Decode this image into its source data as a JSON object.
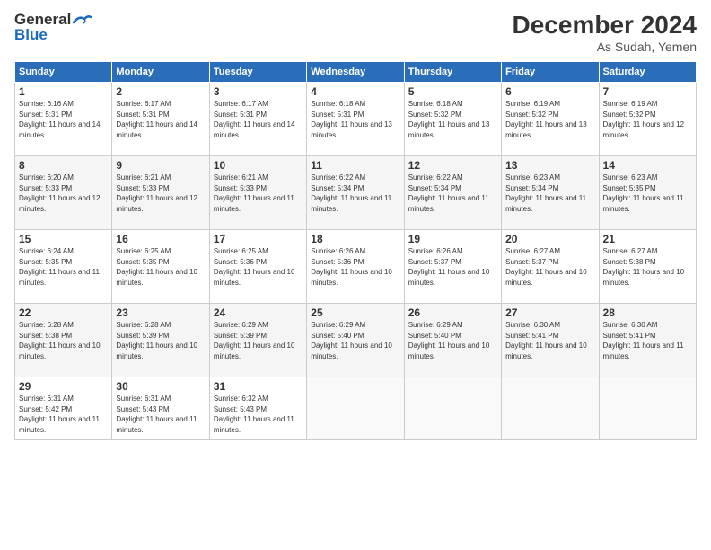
{
  "header": {
    "logo_general": "General",
    "logo_blue": "Blue",
    "month": "December 2024",
    "location": "As Sudah, Yemen"
  },
  "days_of_week": [
    "Sunday",
    "Monday",
    "Tuesday",
    "Wednesday",
    "Thursday",
    "Friday",
    "Saturday"
  ],
  "weeks": [
    [
      {
        "day": "1",
        "sunrise": "6:16 AM",
        "sunset": "5:31 PM",
        "daylight": "11 hours and 14 minutes."
      },
      {
        "day": "2",
        "sunrise": "6:17 AM",
        "sunset": "5:31 PM",
        "daylight": "11 hours and 14 minutes."
      },
      {
        "day": "3",
        "sunrise": "6:17 AM",
        "sunset": "5:31 PM",
        "daylight": "11 hours and 14 minutes."
      },
      {
        "day": "4",
        "sunrise": "6:18 AM",
        "sunset": "5:31 PM",
        "daylight": "11 hours and 13 minutes."
      },
      {
        "day": "5",
        "sunrise": "6:18 AM",
        "sunset": "5:32 PM",
        "daylight": "11 hours and 13 minutes."
      },
      {
        "day": "6",
        "sunrise": "6:19 AM",
        "sunset": "5:32 PM",
        "daylight": "11 hours and 13 minutes."
      },
      {
        "day": "7",
        "sunrise": "6:19 AM",
        "sunset": "5:32 PM",
        "daylight": "11 hours and 12 minutes."
      }
    ],
    [
      {
        "day": "8",
        "sunrise": "6:20 AM",
        "sunset": "5:33 PM",
        "daylight": "11 hours and 12 minutes."
      },
      {
        "day": "9",
        "sunrise": "6:21 AM",
        "sunset": "5:33 PM",
        "daylight": "11 hours and 12 minutes."
      },
      {
        "day": "10",
        "sunrise": "6:21 AM",
        "sunset": "5:33 PM",
        "daylight": "11 hours and 11 minutes."
      },
      {
        "day": "11",
        "sunrise": "6:22 AM",
        "sunset": "5:34 PM",
        "daylight": "11 hours and 11 minutes."
      },
      {
        "day": "12",
        "sunrise": "6:22 AM",
        "sunset": "5:34 PM",
        "daylight": "11 hours and 11 minutes."
      },
      {
        "day": "13",
        "sunrise": "6:23 AM",
        "sunset": "5:34 PM",
        "daylight": "11 hours and 11 minutes."
      },
      {
        "day": "14",
        "sunrise": "6:23 AM",
        "sunset": "5:35 PM",
        "daylight": "11 hours and 11 minutes."
      }
    ],
    [
      {
        "day": "15",
        "sunrise": "6:24 AM",
        "sunset": "5:35 PM",
        "daylight": "11 hours and 11 minutes."
      },
      {
        "day": "16",
        "sunrise": "6:25 AM",
        "sunset": "5:35 PM",
        "daylight": "11 hours and 10 minutes."
      },
      {
        "day": "17",
        "sunrise": "6:25 AM",
        "sunset": "5:36 PM",
        "daylight": "11 hours and 10 minutes."
      },
      {
        "day": "18",
        "sunrise": "6:26 AM",
        "sunset": "5:36 PM",
        "daylight": "11 hours and 10 minutes."
      },
      {
        "day": "19",
        "sunrise": "6:26 AM",
        "sunset": "5:37 PM",
        "daylight": "11 hours and 10 minutes."
      },
      {
        "day": "20",
        "sunrise": "6:27 AM",
        "sunset": "5:37 PM",
        "daylight": "11 hours and 10 minutes."
      },
      {
        "day": "21",
        "sunrise": "6:27 AM",
        "sunset": "5:38 PM",
        "daylight": "11 hours and 10 minutes."
      }
    ],
    [
      {
        "day": "22",
        "sunrise": "6:28 AM",
        "sunset": "5:38 PM",
        "daylight": "11 hours and 10 minutes."
      },
      {
        "day": "23",
        "sunrise": "6:28 AM",
        "sunset": "5:39 PM",
        "daylight": "11 hours and 10 minutes."
      },
      {
        "day": "24",
        "sunrise": "6:29 AM",
        "sunset": "5:39 PM",
        "daylight": "11 hours and 10 minutes."
      },
      {
        "day": "25",
        "sunrise": "6:29 AM",
        "sunset": "5:40 PM",
        "daylight": "11 hours and 10 minutes."
      },
      {
        "day": "26",
        "sunrise": "6:29 AM",
        "sunset": "5:40 PM",
        "daylight": "11 hours and 10 minutes."
      },
      {
        "day": "27",
        "sunrise": "6:30 AM",
        "sunset": "5:41 PM",
        "daylight": "11 hours and 10 minutes."
      },
      {
        "day": "28",
        "sunrise": "6:30 AM",
        "sunset": "5:41 PM",
        "daylight": "11 hours and 11 minutes."
      }
    ],
    [
      {
        "day": "29",
        "sunrise": "6:31 AM",
        "sunset": "5:42 PM",
        "daylight": "11 hours and 11 minutes."
      },
      {
        "day": "30",
        "sunrise": "6:31 AM",
        "sunset": "5:43 PM",
        "daylight": "11 hours and 11 minutes."
      },
      {
        "day": "31",
        "sunrise": "6:32 AM",
        "sunset": "5:43 PM",
        "daylight": "11 hours and 11 minutes."
      },
      null,
      null,
      null,
      null
    ]
  ]
}
